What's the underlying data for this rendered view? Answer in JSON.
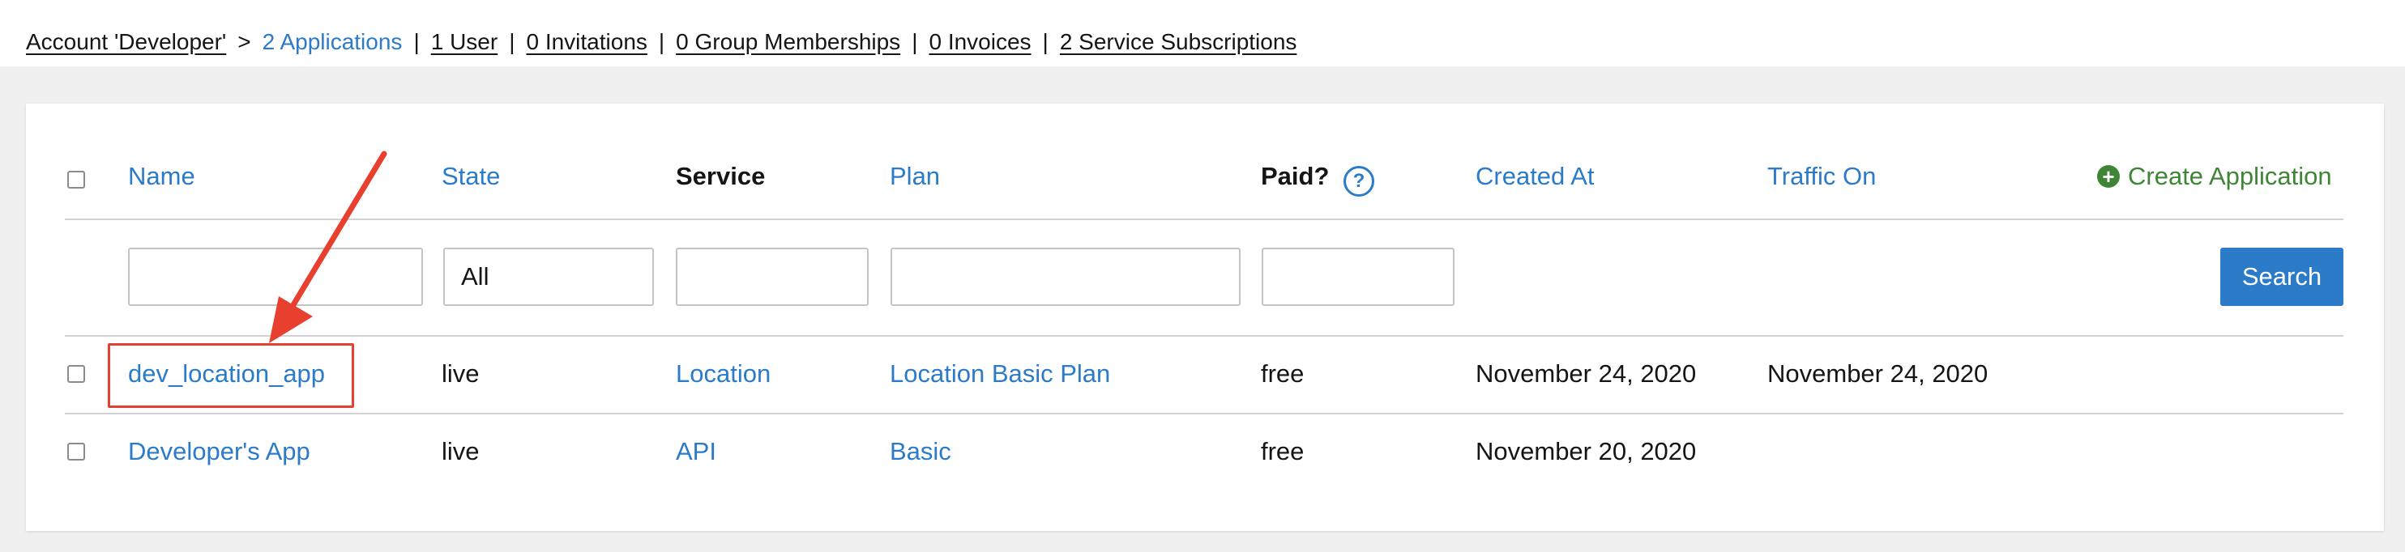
{
  "breadcrumb": {
    "account": "Account 'Developer'",
    "separator": ">",
    "applications": "2 Applications",
    "users": "1 User",
    "invitations": "0 Invitations",
    "group_memberships": "0 Group Memberships",
    "invoices": "0 Invoices",
    "service_subscriptions": "2 Service Subscriptions",
    "pipe": "|"
  },
  "table": {
    "headers": {
      "name": "Name",
      "state": "State",
      "service": "Service",
      "plan": "Plan",
      "paid": "Paid?",
      "created_at": "Created At",
      "traffic_on": "Traffic On"
    },
    "help_icon": "?",
    "create_application": "Create Application",
    "filters": {
      "state_value": "All",
      "search_label": "Search"
    },
    "rows": [
      {
        "name": "dev_location_app",
        "state": "live",
        "service": "Location",
        "plan": "Location Basic Plan",
        "paid": "free",
        "created_at": "November 24, 2020",
        "traffic_on": "November 24, 2020"
      },
      {
        "name": "Developer's App",
        "state": "live",
        "service": "API",
        "plan": "Basic",
        "paid": "free",
        "created_at": "November 20, 2020",
        "traffic_on": ""
      }
    ]
  },
  "colors": {
    "link": "#2b7bc8",
    "create": "#3e8635",
    "annotation": "#e8402f"
  },
  "icons": {
    "help": "question-circle-icon",
    "create": "plus-circle-icon",
    "annotation": "arrow-annotation"
  }
}
